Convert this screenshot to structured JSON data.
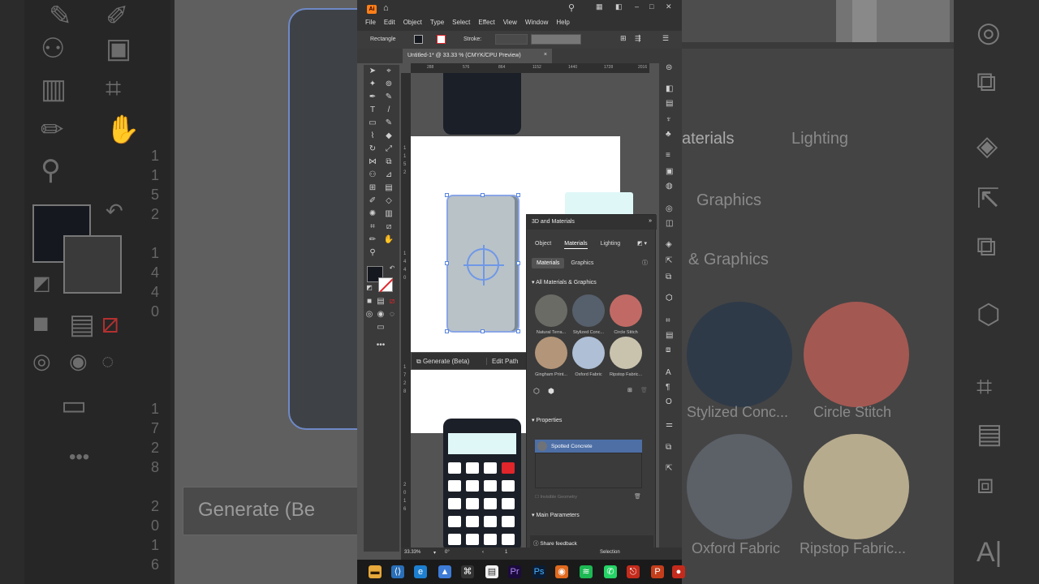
{
  "menubar": {
    "app_icon": "Ai",
    "items": [
      "File",
      "Edit",
      "Object",
      "Type",
      "Select",
      "Effect",
      "View",
      "Window",
      "Help"
    ]
  },
  "control_bar": {
    "object_type": "Rectangle",
    "stroke_label": "Stroke:"
  },
  "document_tab": {
    "title": "Untitled-1* @ 33.33 % (CMYK/CPU Preview)",
    "close_glyph": "×"
  },
  "ruler": {
    "top_ticks": [
      "288",
      "576",
      "864",
      "1152",
      "1440",
      "1728",
      "2016"
    ],
    "left_ticks": [
      "1",
      "1",
      "5",
      "2",
      "1",
      "4",
      "4",
      "0",
      "1",
      "7",
      "2",
      "8",
      "2",
      "0",
      "1",
      "6"
    ]
  },
  "contextual_bar": {
    "generate_label": "Generate (Beta)",
    "edit_path_label": "Edit Path"
  },
  "panel_3d": {
    "title": "3D and Materials",
    "tabs": [
      "Object",
      "Materials",
      "Lighting"
    ],
    "segments": [
      "Materials",
      "Graphics"
    ],
    "section_all": "All Materials & Graphics",
    "materials": [
      {
        "name": "Natural Terra...",
        "color": "#6b6b66"
      },
      {
        "name": "Stylized Conc...",
        "color": "#56606c"
      },
      {
        "name": "Circle Stitch",
        "color": "#c16a65"
      },
      {
        "name": "Gingham Print...",
        "color": "#b39579"
      },
      {
        "name": "Oxford Fabric",
        "color": "#aebfd6"
      },
      {
        "name": "Ripstop Fabric...",
        "color": "#c9c3ae"
      }
    ],
    "properties_label": "Properties",
    "selected_material": "Spotted Concrete",
    "invisible_geometry": "Invisible Geometry",
    "main_parameters": "Main Parameters",
    "share_feedback": "Share feedback"
  },
  "status_bar": {
    "zoom": "33.33%",
    "rotation": "0°",
    "artboard": "1",
    "mode": "Selection"
  },
  "background_right": {
    "tabs": [
      "aterials",
      "Lighting"
    ],
    "graphics": "Graphics",
    "section": "& Graphics",
    "materials": [
      "Stylized Conc...",
      "Circle Stitch",
      "Oxford Fabric",
      "Ripstop Fabric..."
    ]
  },
  "background_left": {
    "generate": "Generate (Be"
  }
}
